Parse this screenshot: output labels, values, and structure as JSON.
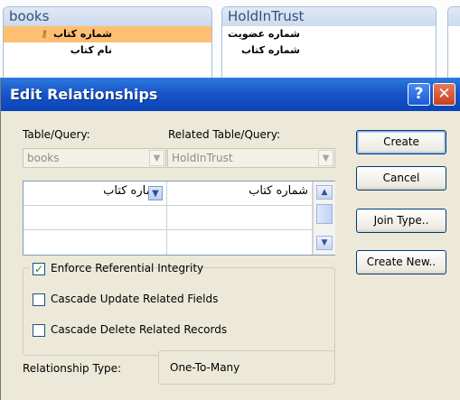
{
  "background": {
    "tables": [
      {
        "name": "books",
        "fields": [
          {
            "label": "شماره کتاب",
            "key": true
          },
          {
            "label": "نام کتاب",
            "key": false
          }
        ]
      },
      {
        "name": "HoldInTrust",
        "fields": [
          {
            "label": "شماره عضویت"
          },
          {
            "label": "شماره کتاب"
          }
        ]
      }
    ]
  },
  "dialog": {
    "title": "Edit Relationships",
    "help_glyph": "?",
    "close_glyph": "✕",
    "table_query_label": "Table/Query:",
    "related_label": "Related Table/Query:",
    "table_value": "books",
    "related_value": "HoldInTrust",
    "grid": {
      "rows": [
        {
          "left": "شماره کتاب",
          "right": "شماره کتاب"
        },
        {
          "left": "",
          "right": ""
        },
        {
          "left": "",
          "right": ""
        }
      ]
    },
    "options": {
      "enforce": {
        "label": "Enforce Referential Integrity",
        "checked": true
      },
      "cascade_update": {
        "label": "Cascade Update Related Fields",
        "checked": false
      },
      "cascade_delete": {
        "label": "Cascade Delete Related Records",
        "checked": false
      }
    },
    "relationship_type_label": "Relationship Type:",
    "relationship_type_value": "One-To-Many",
    "buttons": {
      "create": "Create",
      "cancel": "Cancel",
      "join_type": "Join Type..",
      "create_new": "Create New.."
    }
  }
}
